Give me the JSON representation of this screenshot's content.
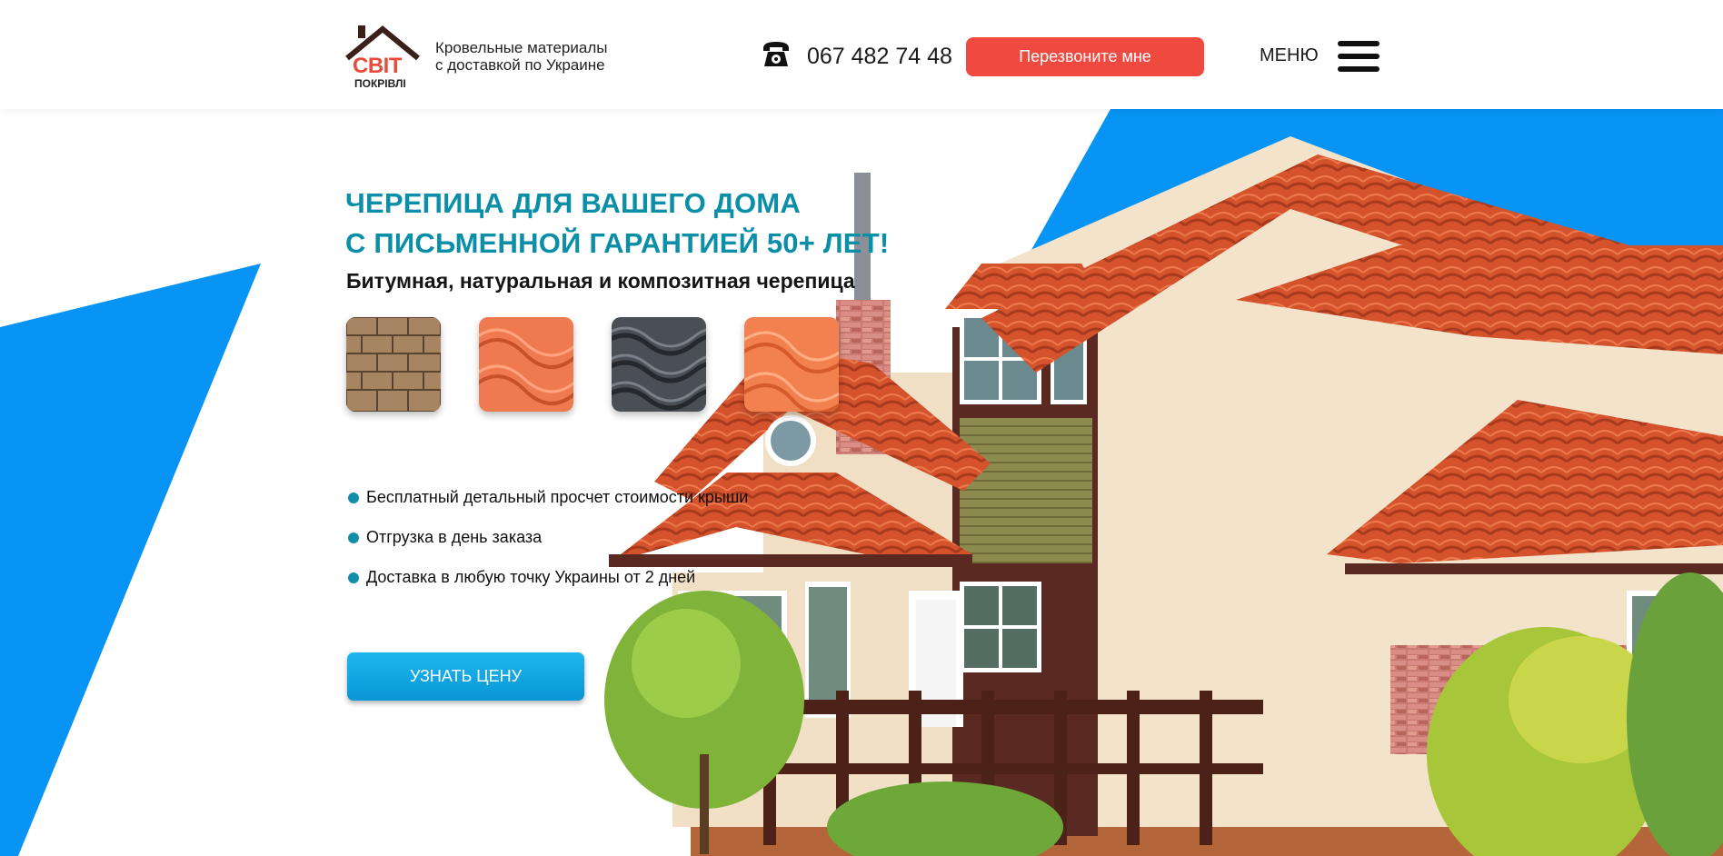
{
  "header": {
    "logo_text": "СВІТ",
    "logo_subtext": "ПОКРІВЛІ",
    "tagline_line1": "Кровельные материалы",
    "tagline_line2": "с доставкой по Украине",
    "phone": "067 482 74 48",
    "callback_label": "Перезвоните мне",
    "menu_label": "МЕНЮ"
  },
  "hero": {
    "headline_line1": "ЧЕРЕПИЦА ДЛЯ ВАШЕГО ДОМА",
    "headline_line2": "С ПИСЬМЕННОЙ ГАРАНТИЕЙ 50+ ЛЕТ!",
    "subheadline": "Битумная, натуральная и композитная черепица",
    "tiles": [
      "bitumen-tile",
      "ceramic-tile",
      "composite-tile",
      "natural-tile"
    ],
    "benefits": [
      "Бесплатный детальный просчет стоимости крыши",
      "Отгрузка в день заказа",
      "Доставка в любую точку Украины от 2 дней"
    ],
    "cta_label": "УЗНАТЬ ЦЕНУ"
  },
  "colors": {
    "accent_blue": "#0894f4",
    "headline_teal": "#0b8fa8",
    "callback_red": "#f04a40",
    "roof_red": "#d9542f"
  }
}
